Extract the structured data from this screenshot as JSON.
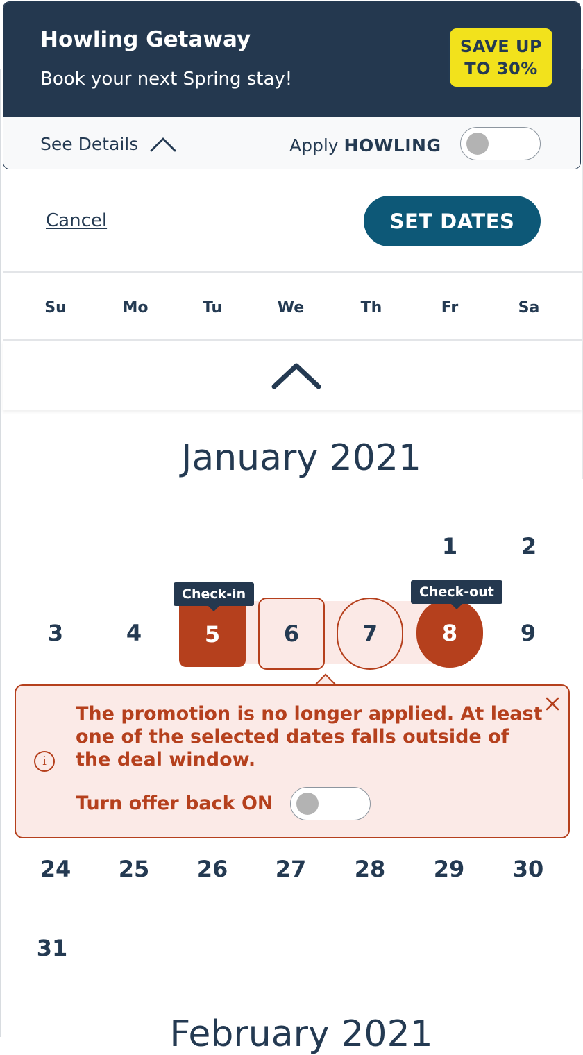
{
  "promo": {
    "title": "Howling Getaway",
    "subtitle": "Book your next Spring stay!",
    "badge_line1": "SAVE UP",
    "badge_line2": "TO 30%",
    "see_details_label": "See Details",
    "apply_prefix": "Apply",
    "apply_code": "HOWLING",
    "toggle_on": false
  },
  "actions": {
    "cancel_label": "Cancel",
    "set_dates_label": "SET DATES"
  },
  "weekdays": [
    "Su",
    "Mo",
    "Tu",
    "We",
    "Th",
    "Fr",
    "Sa"
  ],
  "calendar": {
    "january_title": "January 2021",
    "february_title": "February 2021",
    "week1": [
      "1",
      "2"
    ],
    "week2": [
      "3",
      "4",
      "5",
      "6",
      "7",
      "8",
      "9"
    ],
    "week5": [
      "24",
      "25",
      "26",
      "27",
      "28",
      "29",
      "30"
    ],
    "week6": [
      "31"
    ],
    "checkin_tag": "Check-in",
    "checkout_tag": "Check-out"
  },
  "warning": {
    "message": "The promotion is no longer applied. At least one of the selected dates falls outside of the deal window.",
    "offer_label": "Turn offer back ON",
    "icon_glyph": "i",
    "toggle_on": false
  },
  "colors": {
    "header_navy": "#24384f",
    "badge_yellow": "#f2e21c",
    "button_teal": "#0d5877",
    "accent_rust": "#b5401d",
    "range_pink": "#fbe9e6"
  }
}
